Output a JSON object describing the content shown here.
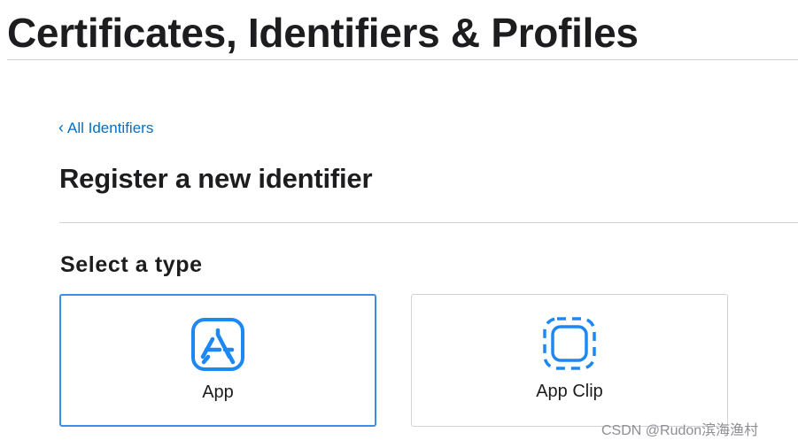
{
  "header": {
    "title": "Certificates, Identifiers & Profiles"
  },
  "breadcrumb": {
    "back_label": "All Identifiers",
    "chevron": "‹"
  },
  "page": {
    "title": "Register a new identifier",
    "select_type_heading": "Select a type"
  },
  "identifier_types": [
    {
      "label": "App",
      "icon": "app-store-icon",
      "selected": true
    },
    {
      "label": "App Clip",
      "icon": "app-clip-icon",
      "selected": false
    }
  ],
  "watermark": {
    "text": "CSDN @Rudon滨海渔村"
  },
  "colors": {
    "link": "#0070c9",
    "selected_border": "#3b8ee8",
    "icon_blue": "#1e88f2",
    "divider": "#d2d2d7",
    "text": "#1d1d1f",
    "watermark": "#8e8e93"
  }
}
